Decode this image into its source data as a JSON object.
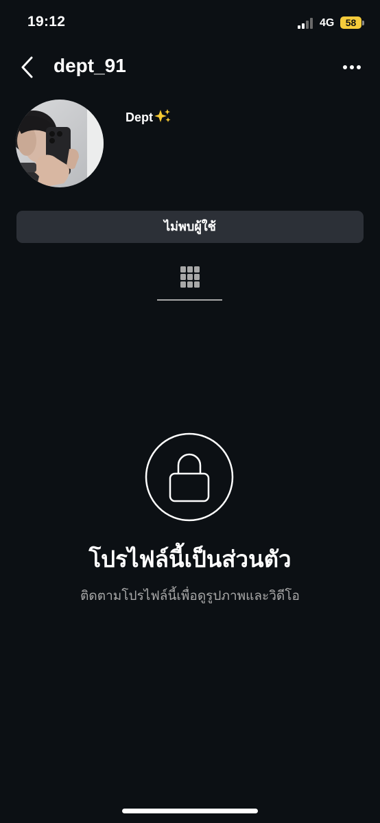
{
  "status_bar": {
    "time": "19:12",
    "network": "4G",
    "battery": "58"
  },
  "header": {
    "username": "dept_91"
  },
  "profile": {
    "display_name": "Dept",
    "status_button_label": "ไม่พบผู้ใช้"
  },
  "tabs": [
    {
      "icon": "grid-icon",
      "active": true
    }
  ],
  "private_notice": {
    "title": "โปรไฟล์นี้เป็นส่วนตัว",
    "subtitle": "ติดตามโปรไฟล์นี้เพื่อดูรูปภาพและวิดีโอ"
  },
  "colors": {
    "background": "#0c1014",
    "button": "#2c3037",
    "secondary_text": "#a8a8a8",
    "battery": "#f4cb3b",
    "sparkle": "#f5c932"
  }
}
